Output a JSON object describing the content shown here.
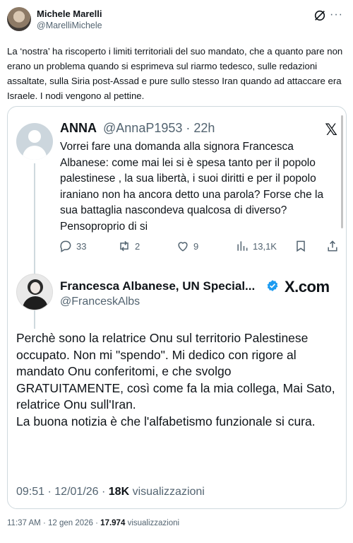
{
  "post": {
    "author_name": "Michele Marelli",
    "author_handle": "@MarelliMichele",
    "text": "La ‘nostra’ ha riscoperto i limiti territoriali del suo mandato, che a quanto pare non erano un problema quando si esprimeva sul riarmo tedesco, sulle redazioni assaltate, sulla Siria post-Assad e pure sullo stesso Iran quando ad attaccare era Israele. I nodi vengono al pettine.",
    "time": "11:37 AM",
    "date": "12 gen 2026",
    "views": "17.974",
    "views_label": "visualizzazioni"
  },
  "quoted_reply": {
    "author_name": "ANNA",
    "author_handle": "@AnnaP1953",
    "age": "· 22h",
    "text": "Vorrei fare una domanda alla signora Francesca Albanese: come mai lei si è spesa tanto per il popolo palestinese , la sua libertà, i suoi diritti e per il popolo iraniano non ha ancora detto una parola? Forse che la sua battaglia nascondeva qualcosa di diverso? Pensoproprio di si",
    "replies": "33",
    "reposts": "2",
    "likes": "9",
    "views": "13,1K"
  },
  "source_post": {
    "author_name": "Francesca Albanese, UN Special...",
    "author_handle": "@FranceskAlbs",
    "site_label": "X.com",
    "text": "Perchè sono la relatrice Onu sul territorio Palestinese occupato. Non mi \"spendo\". Mi dedico con rigore al mandato Onu conferitomi, e che svolgo GRATUITAMENTE, così come fa la mia collega, Mai Sato, relatrice Onu sull'Iran.\nLa buona notizia è che l'alfabetismo funzionale si cura.",
    "time": "09:51",
    "date": "· 12/01/26 ·",
    "views": "18K",
    "views_label": "visualizzazioni"
  },
  "icons": {
    "grok": "grok-icon",
    "more": "more-icon",
    "x_logo": "x-logo-icon",
    "reply": "reply-icon",
    "repost": "repost-icon",
    "like": "heart-icon",
    "views": "views-icon",
    "bookmark": "bookmark-icon",
    "share": "share-icon",
    "verified": "verified-icon"
  },
  "colors": {
    "text": "#0f1419",
    "secondary": "#536471",
    "border": "#cfd9de",
    "verified": "#1d9bf0"
  }
}
